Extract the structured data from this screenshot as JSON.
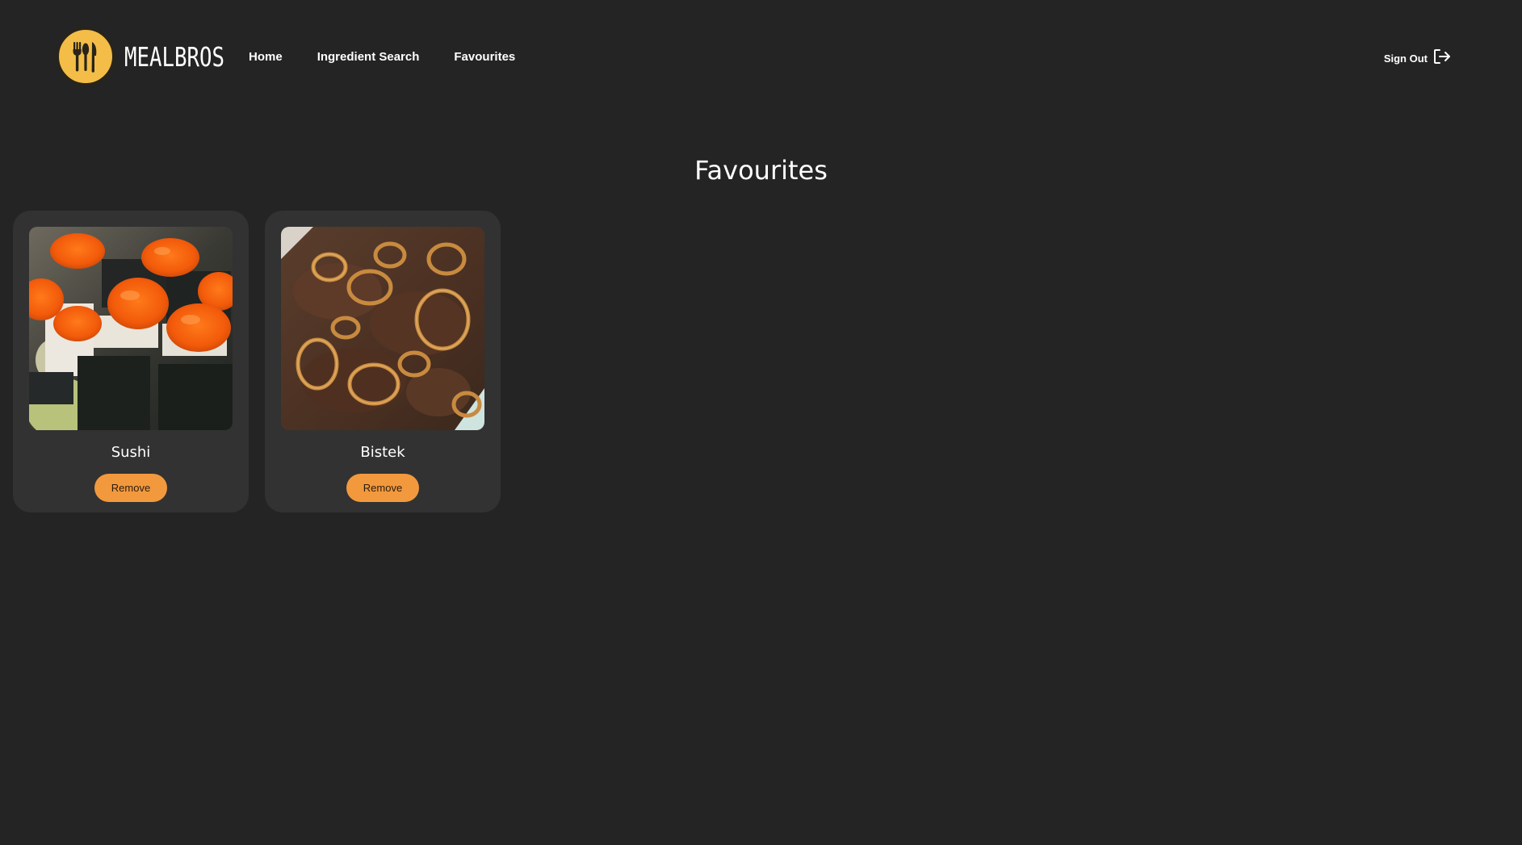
{
  "brand": {
    "name": "MEALBROS",
    "accent_color": "#f3bd47"
  },
  "nav": {
    "links": [
      {
        "label": "Home"
      },
      {
        "label": "Ingredient Search"
      },
      {
        "label": "Favourites"
      }
    ],
    "sign_out_label": "Sign Out",
    "sign_out_icon": "sign-out-icon"
  },
  "page": {
    "title": "Favourites",
    "background_color": "#242424"
  },
  "favourites": [
    {
      "name": "Sushi",
      "image": "sushi-photo",
      "remove_label": "Remove"
    },
    {
      "name": "Bistek",
      "image": "bistek-photo",
      "remove_label": "Remove"
    }
  ],
  "colors": {
    "card_bg": "#323232",
    "button": "#f2993e"
  }
}
